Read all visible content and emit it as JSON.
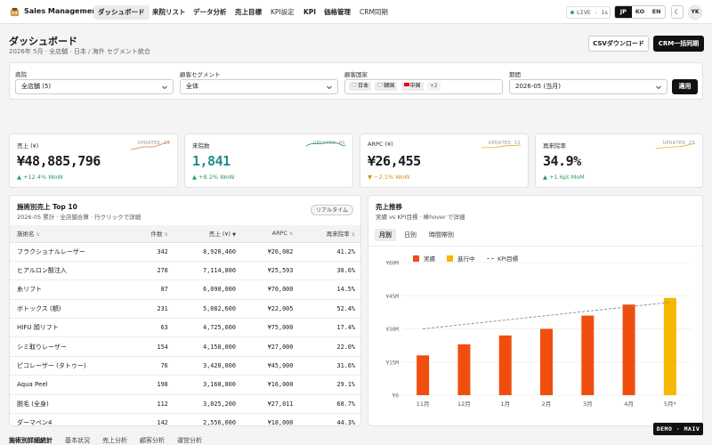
{
  "nav": {
    "app_title": "Sales Management",
    "items": [
      {
        "label": "ダッシュボード",
        "active": true
      },
      {
        "label": "来院リスト"
      },
      {
        "label": "データ分析"
      },
      {
        "label": "売上目標"
      },
      {
        "label": "KPI設定"
      },
      {
        "label": "KPI"
      },
      {
        "label": "価格管理"
      },
      {
        "label": "CRM同期"
      }
    ],
    "live": "LIVE · 1s",
    "languages": [
      "JP",
      "KO",
      "EN"
    ],
    "active_language": "JP",
    "theme_icon": "moon-icon",
    "avatar": "YK"
  },
  "header": {
    "title": "ダッシュボード",
    "subtitle": "2026年 5月 · 全店舗 · 日本 / 海外 セグメント統合",
    "csv_button": "CSVダウンロード",
    "crm_button": "CRM一括同期"
  },
  "filters": {
    "clinic": {
      "label": "病院",
      "value": "全店舗 (5)"
    },
    "segment": {
      "label": "顧客セグメント",
      "value": "全体"
    },
    "country": {
      "label": "顧客国家",
      "chips": [
        "日本",
        "韓国",
        "中国"
      ],
      "more": "+2"
    },
    "period": {
      "label": "期間",
      "value": "2026-05 (当月)"
    },
    "apply": "適用"
  },
  "kpis": [
    {
      "label": "売上 (¥)",
      "updated": "UPDATED 1S",
      "value": "¥48,885,796",
      "delta": "▲ +12.4% WoW",
      "trend": "up"
    },
    {
      "label": "来院数",
      "updated": "UPDATED 0S",
      "value": "1,841",
      "delta": "▲ +8.2% WoW",
      "trend": "up"
    },
    {
      "label": "ARPC (¥)",
      "updated": "UPDATED 1S",
      "value": "¥26,455",
      "delta": "▼ −2.1% WoW",
      "trend": "down"
    },
    {
      "label": "再来院率",
      "updated": "UPDATED 2S",
      "value": "34.9%",
      "delta": "▲ +1.6pt MoM",
      "trend": "up"
    }
  ],
  "table": {
    "title": "施術別売上 Top 10",
    "subtitle": "2026-05 累計 · 全店舗合算 · 行クリックで詳細",
    "badge": "リアルタイム",
    "columns": [
      "施術名",
      "件数",
      "売上 (¥)",
      "ARPC",
      "再来院率"
    ],
    "rows": [
      [
        "フラクショナルレーザー",
        "342",
        "8,920,400",
        "¥26,082",
        "41.2%"
      ],
      [
        "ヒアルロン酸注入",
        "278",
        "7,114,800",
        "¥25,593",
        "38.6%"
      ],
      [
        "糸リフト",
        "87",
        "6,090,000",
        "¥70,000",
        "14.5%"
      ],
      [
        "ボトックス (額)",
        "231",
        "5,082,600",
        "¥22,005",
        "52.4%"
      ],
      [
        "HIFU 顔リフト",
        "63",
        "4,725,000",
        "¥75,000",
        "17.4%"
      ],
      [
        "シミ取りレーザー",
        "154",
        "4,158,000",
        "¥27,000",
        "22.0%"
      ],
      [
        "ピコレーザー (タトゥー)",
        "76",
        "3,420,000",
        "¥45,000",
        "31.6%"
      ],
      [
        "Aqua Peel",
        "198",
        "3,168,000",
        "¥16,000",
        "29.1%"
      ],
      [
        "脱毛 (全身)",
        "112",
        "3,025,200",
        "¥27,011",
        "68.7%"
      ],
      [
        "ダーマペン4",
        "142",
        "2,556,000",
        "¥18,000",
        "44.3%"
      ]
    ]
  },
  "chart_panel": {
    "title": "売上推移",
    "subtitle": "実績 vs KPI目標 · 棒hover で詳細",
    "tabs": [
      "月別",
      "日別",
      "時間帯別"
    ],
    "active_tab": "月別"
  },
  "chart_data": {
    "type": "bar",
    "categories": [
      "11月",
      "12月",
      "1月",
      "2月",
      "3月",
      "4月",
      "5月*"
    ],
    "series": [
      {
        "name": "実績",
        "color": "#f04e0f",
        "values": [
          18,
          23,
          27,
          30,
          36,
          41,
          null
        ]
      },
      {
        "name": "進行中",
        "color": "#f5b800",
        "values": [
          null,
          null,
          null,
          null,
          null,
          null,
          44
        ]
      },
      {
        "name": "KPI目標",
        "type": "line",
        "style": "dashed",
        "color": "#888888",
        "values": [
          30,
          32,
          34,
          36,
          38,
          40,
          42
        ]
      }
    ],
    "yticks": [
      "¥0",
      "¥15M",
      "¥30M",
      "¥45M",
      "¥60M"
    ],
    "ylim": [
      0,
      60
    ],
    "ylabel_unit": "¥M",
    "legend": "top-left",
    "grid": true
  },
  "demo_badge": "DEMO · MAIV",
  "bottom_tabs": [
    "施術別詳細統計",
    "基本状況",
    "売上分析",
    "顧客分析",
    "運営分析"
  ]
}
